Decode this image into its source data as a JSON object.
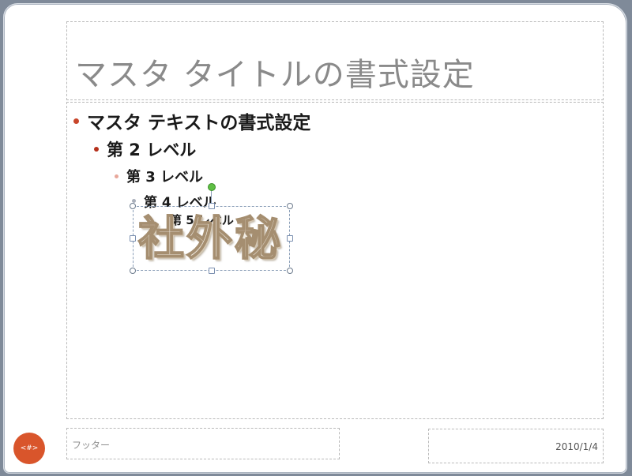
{
  "slide": {
    "title": "マスタ タイトルの書式設定",
    "levels": [
      "マスタ テキストの書式設定",
      "第 2 レベル",
      "第 3 レベル",
      "第 4 レベル",
      "第 5 レベル"
    ],
    "wordart": "社外秘",
    "footer": "フッター",
    "date": "2010/1/4",
    "slide_number": "<#>"
  },
  "colors": {
    "accent": "#d9552b",
    "bullet_level1": "#c8452a",
    "rotate_handle": "#5fbf44"
  }
}
